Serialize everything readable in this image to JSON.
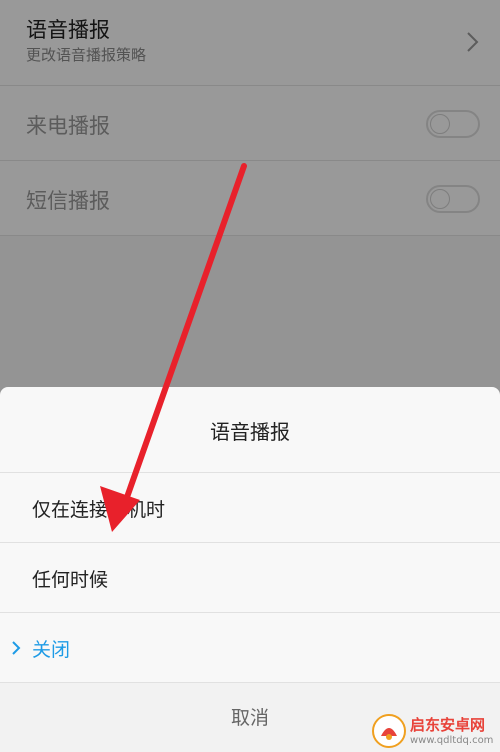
{
  "settings": {
    "voice": {
      "title": "语音播报",
      "subtitle": "更改语音播报策略"
    },
    "call": {
      "title": "来电播报",
      "enabled": false
    },
    "sms": {
      "title": "短信播报",
      "enabled": false
    }
  },
  "dialog": {
    "title": "语音播报",
    "options": [
      {
        "label": "仅在连接耳机时",
        "selected": false
      },
      {
        "label": "任何时候",
        "selected": false
      },
      {
        "label": "关闭",
        "selected": true
      }
    ],
    "cancel": "取消"
  },
  "colors": {
    "accent": "#1e9be6",
    "annotation": "#e8212b"
  },
  "watermark": {
    "name": "启东安卓网",
    "url": "www.qdltdq.com"
  }
}
